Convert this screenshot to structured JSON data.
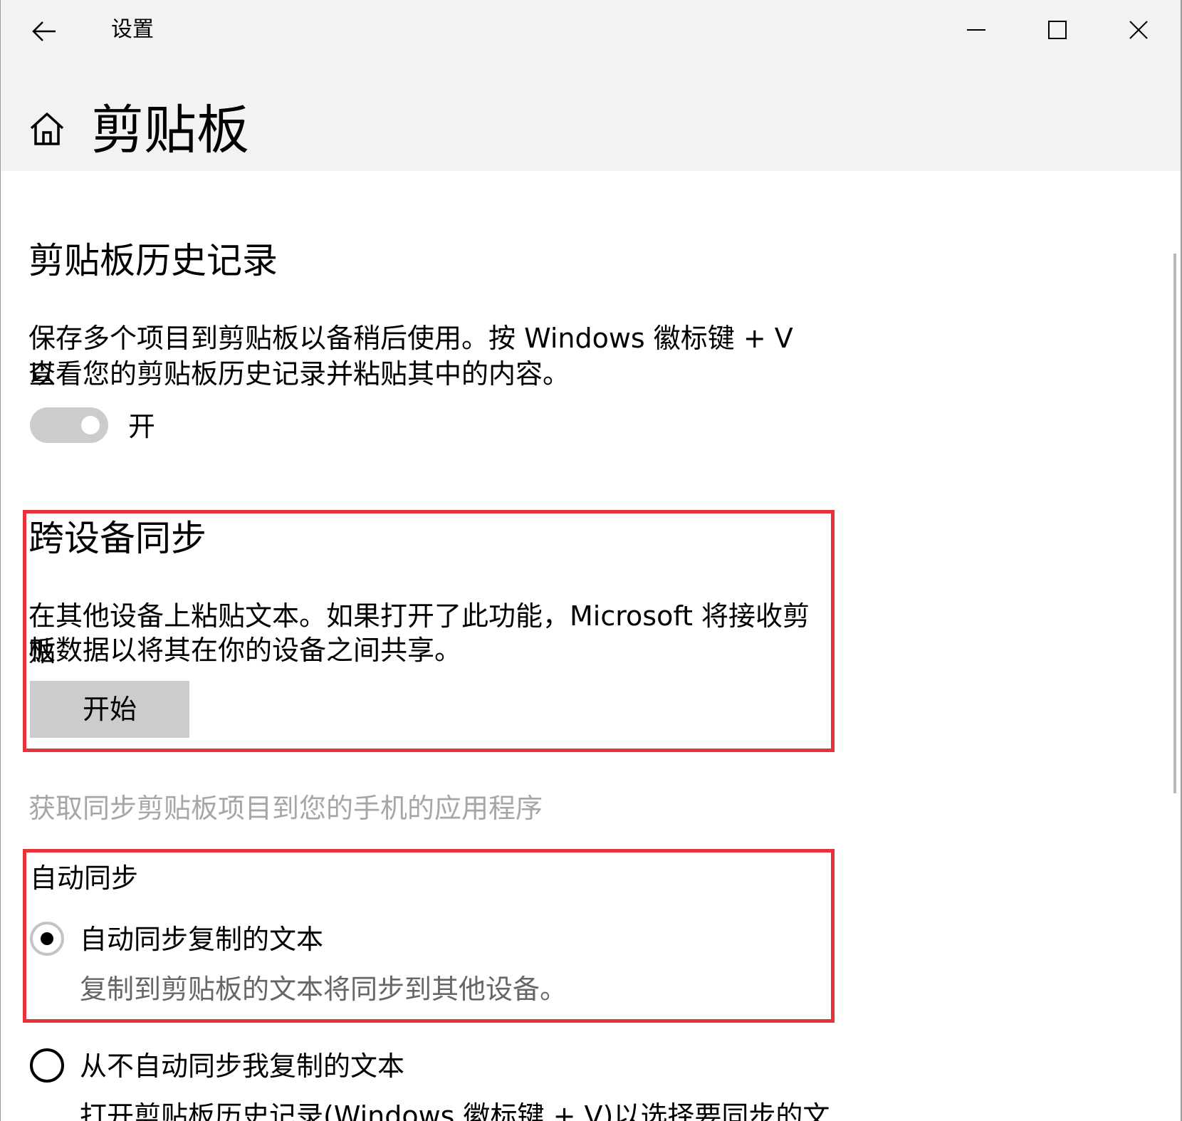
{
  "window": {
    "app_title": "设置",
    "page_title": "剪贴板"
  },
  "history": {
    "heading": "剪贴板历史记录",
    "description_line1": "保存多个项目到剪贴板以备稍后使用。按 Windows 徽标键 + V 以",
    "description_line2": "查看您的剪贴板历史记录并粘贴其中的内容。",
    "toggle_state": "开"
  },
  "sync": {
    "heading": "跨设备同步",
    "description_line1": "在其他设备上粘贴文本。如果打开了此功能，Microsoft 将接收剪贴",
    "description_line2": "板数据以将其在你的设备之间共享。",
    "start_button": "开始",
    "phone_app_link": "获取同步剪贴板项目到您的手机的应用程序"
  },
  "auto_sync": {
    "label": "自动同步",
    "options": [
      {
        "label": "自动同步复制的文本",
        "description": "复制到剪贴板的文本将同步到其他设备。",
        "selected": true
      },
      {
        "label": "从不自动同步我复制的文本",
        "description": "打开剪贴板历史记录(Windows 徽标键 + V)以选择要同步的文",
        "selected": false
      }
    ]
  },
  "colors": {
    "highlight_border": "#e8333a",
    "header_background": "#f2f2f2",
    "button_background": "#cccccc",
    "disabled_text": "#a6a6a6"
  },
  "icons": {
    "back": "back-arrow-icon",
    "home": "home-icon",
    "minimize": "minimize-icon",
    "maximize": "maximize-icon",
    "close": "close-icon"
  }
}
